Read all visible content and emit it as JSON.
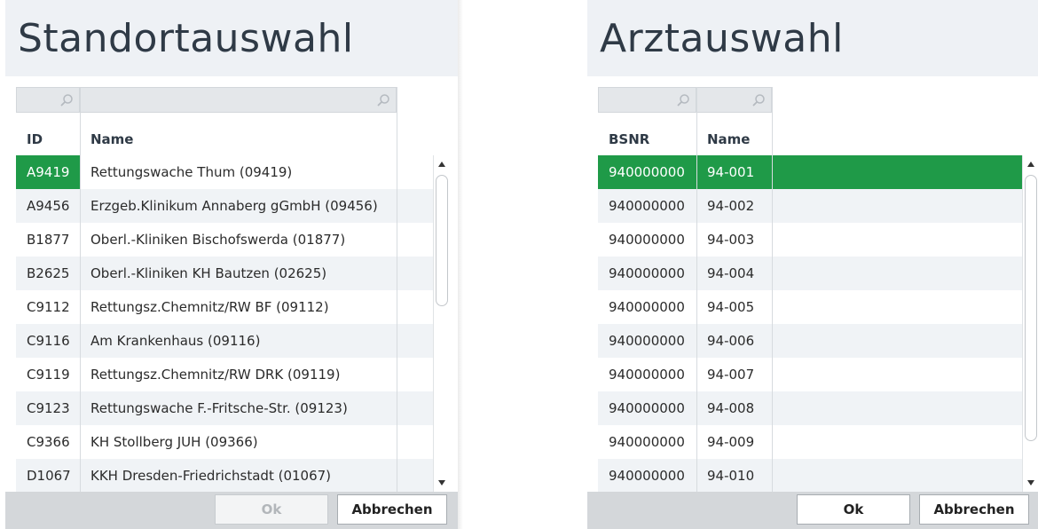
{
  "standort": {
    "title": "Standortauswahl",
    "columns": [
      "ID",
      "Name"
    ],
    "rows": [
      {
        "id": "A9419",
        "name": "Rettungswache Thum (09419)"
      },
      {
        "id": "A9456",
        "name": "Erzgeb.Klinikum Annaberg gGmbH (09456)"
      },
      {
        "id": "B1877",
        "name": "Oberl.-Kliniken Bischofswerda (01877)"
      },
      {
        "id": "B2625",
        "name": "Oberl.-Kliniken KH Bautzen (02625)"
      },
      {
        "id": "C9112",
        "name": "Rettungsz.Chemnitz/RW BF (09112)"
      },
      {
        "id": "C9116",
        "name": "Am Krankenhaus (09116)"
      },
      {
        "id": "C9119",
        "name": "Rettungsz.Chemnitz/RW DRK (09119)"
      },
      {
        "id": "C9123",
        "name": "Rettungswache F.-Fritsche-Str. (09123)"
      },
      {
        "id": "C9366",
        "name": "KH Stollberg JUH (09366)"
      },
      {
        "id": "D1067",
        "name": "KKH Dresden-Friedrichstadt (01067)"
      }
    ],
    "selected_index": 0,
    "ok_label": "Ok",
    "cancel_label": "Abbrechen"
  },
  "arzt": {
    "title": "Arztauswahl",
    "columns": [
      "BSNR",
      "Name"
    ],
    "rows": [
      {
        "bsnr": "940000000",
        "name": "94-001"
      },
      {
        "bsnr": "940000000",
        "name": "94-002"
      },
      {
        "bsnr": "940000000",
        "name": "94-003"
      },
      {
        "bsnr": "940000000",
        "name": "94-004"
      },
      {
        "bsnr": "940000000",
        "name": "94-005"
      },
      {
        "bsnr": "940000000",
        "name": "94-006"
      },
      {
        "bsnr": "940000000",
        "name": "94-007"
      },
      {
        "bsnr": "940000000",
        "name": "94-008"
      },
      {
        "bsnr": "940000000",
        "name": "94-009"
      },
      {
        "bsnr": "940000000",
        "name": "94-010"
      }
    ],
    "selected_index": 0,
    "ok_label": "Ok",
    "cancel_label": "Abbrechen"
  },
  "icons": {
    "filter": "search-icon",
    "scroll_up": "arrow-up-icon",
    "scroll_down": "arrow-down-icon"
  },
  "colors": {
    "selection": "#1f9a48",
    "title_bar": "#eef1f5",
    "footer": "#d4d7da",
    "row_alt": "#f0f3f6"
  }
}
